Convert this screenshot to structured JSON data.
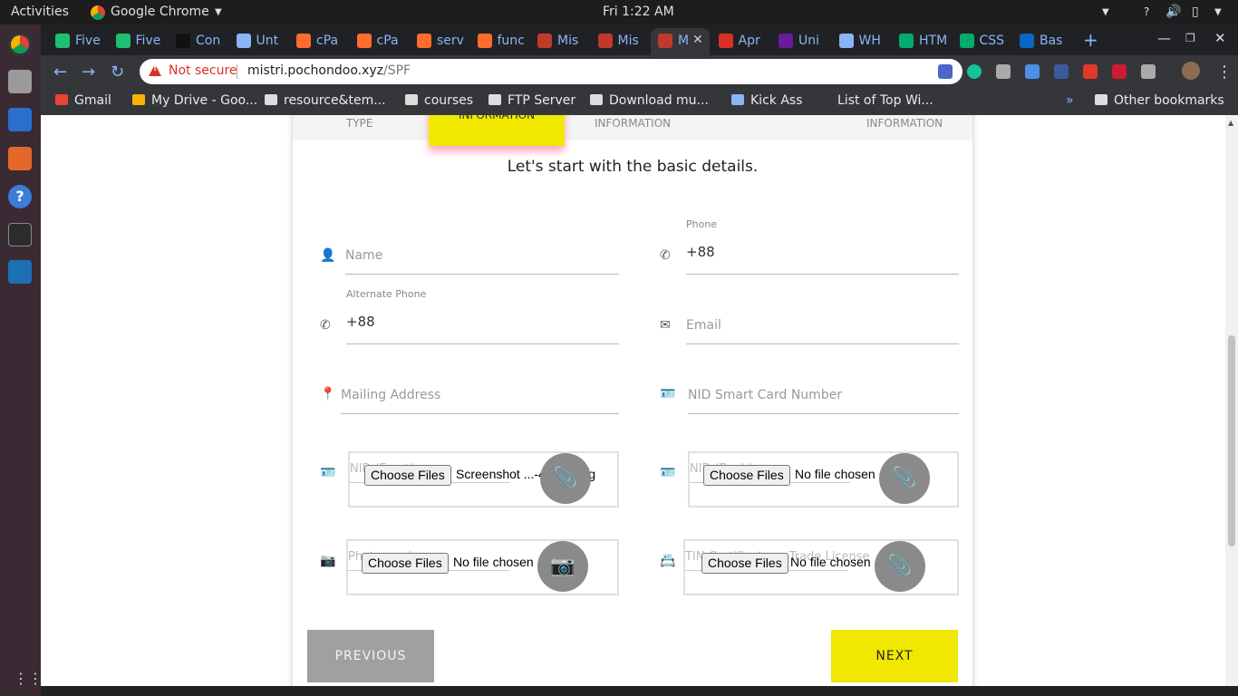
{
  "system": {
    "activities": "Activities",
    "app_name": "Google Chrome",
    "clock": "Fri  1:22 AM"
  },
  "tabs": [
    {
      "title": "Five",
      "icon": "fiverr-icon"
    },
    {
      "title": "Five",
      "icon": "fiverr-icon"
    },
    {
      "title": "Con",
      "icon": "c-logo-icon"
    },
    {
      "title": "Unt",
      "icon": "document-icon"
    },
    {
      "title": "cPa",
      "icon": "cpanel-icon"
    },
    {
      "title": "cPa",
      "icon": "cpanel-icon"
    },
    {
      "title": "serv",
      "icon": "cpanel-icon"
    },
    {
      "title": "func",
      "icon": "cpanel-icon"
    },
    {
      "title": "Mis",
      "icon": "mistri-icon"
    },
    {
      "title": "Mis",
      "icon": "mistri-icon"
    },
    {
      "title": "M",
      "icon": "mistri-icon",
      "active": true
    },
    {
      "title": "Apr",
      "icon": "calendar-icon"
    },
    {
      "title": "Uni",
      "icon": "shield-icon"
    },
    {
      "title": "WH",
      "icon": "document-icon"
    },
    {
      "title": "HTM",
      "icon": "w3-icon"
    },
    {
      "title": "CSS",
      "icon": "w3-icon"
    },
    {
      "title": "Bas",
      "icon": "linkedin-icon"
    }
  ],
  "address_bar": {
    "security": "Not secure",
    "host": "mistri.pochondoo.xyz",
    "path": "/SPF"
  },
  "bookmarks": [
    {
      "label": "Gmail",
      "icon": "gmail-icon"
    },
    {
      "label": "My Drive - Goo...",
      "icon": "drive-icon"
    },
    {
      "label": "resource&tem...",
      "icon": "folder-icon"
    },
    {
      "label": "courses",
      "icon": "folder-icon"
    },
    {
      "label": "FTP Server",
      "icon": "folder-icon"
    },
    {
      "label": "Download mu...",
      "icon": "download-icon"
    },
    {
      "label": "Kick Ass",
      "icon": "document-icon"
    },
    {
      "label": "List of Top Wi...",
      "icon": "globe-icon"
    }
  ],
  "other_bookmarks": "Other bookmarks",
  "form": {
    "steps": [
      "TYPE",
      "INFORMATION",
      "INFORMATION",
      "INFORMATION"
    ],
    "heading": "Let's start with the basic details.",
    "name": {
      "placeholder": "Name"
    },
    "phone": {
      "label": "Phone",
      "value": "+88"
    },
    "alt_phone": {
      "label": "Alternate Phone",
      "value": "+88"
    },
    "email": {
      "placeholder": "Email"
    },
    "address": {
      "placeholder": "Mailing Address"
    },
    "nid": {
      "placeholder": "NID Smart Card Number"
    },
    "nid_front": {
      "label": "NID (Front)",
      "button": "Choose Files",
      "file": "Screenshot ...-43-53.png"
    },
    "nid_back": {
      "label": "NID (Back)",
      "button": "Choose Files",
      "file": "No file chosen"
    },
    "photo": {
      "label": "Photograph",
      "button": "Choose Files",
      "file": "No file chosen"
    },
    "tin": {
      "label": "TIN Certificate or Trade License",
      "button": "Choose Files",
      "file": "No file chosen"
    },
    "previous": "PREVIOUS",
    "next": "NEXT"
  },
  "colors": {
    "accent": "#f0e800",
    "previous_bg": "#a0a0a0"
  }
}
